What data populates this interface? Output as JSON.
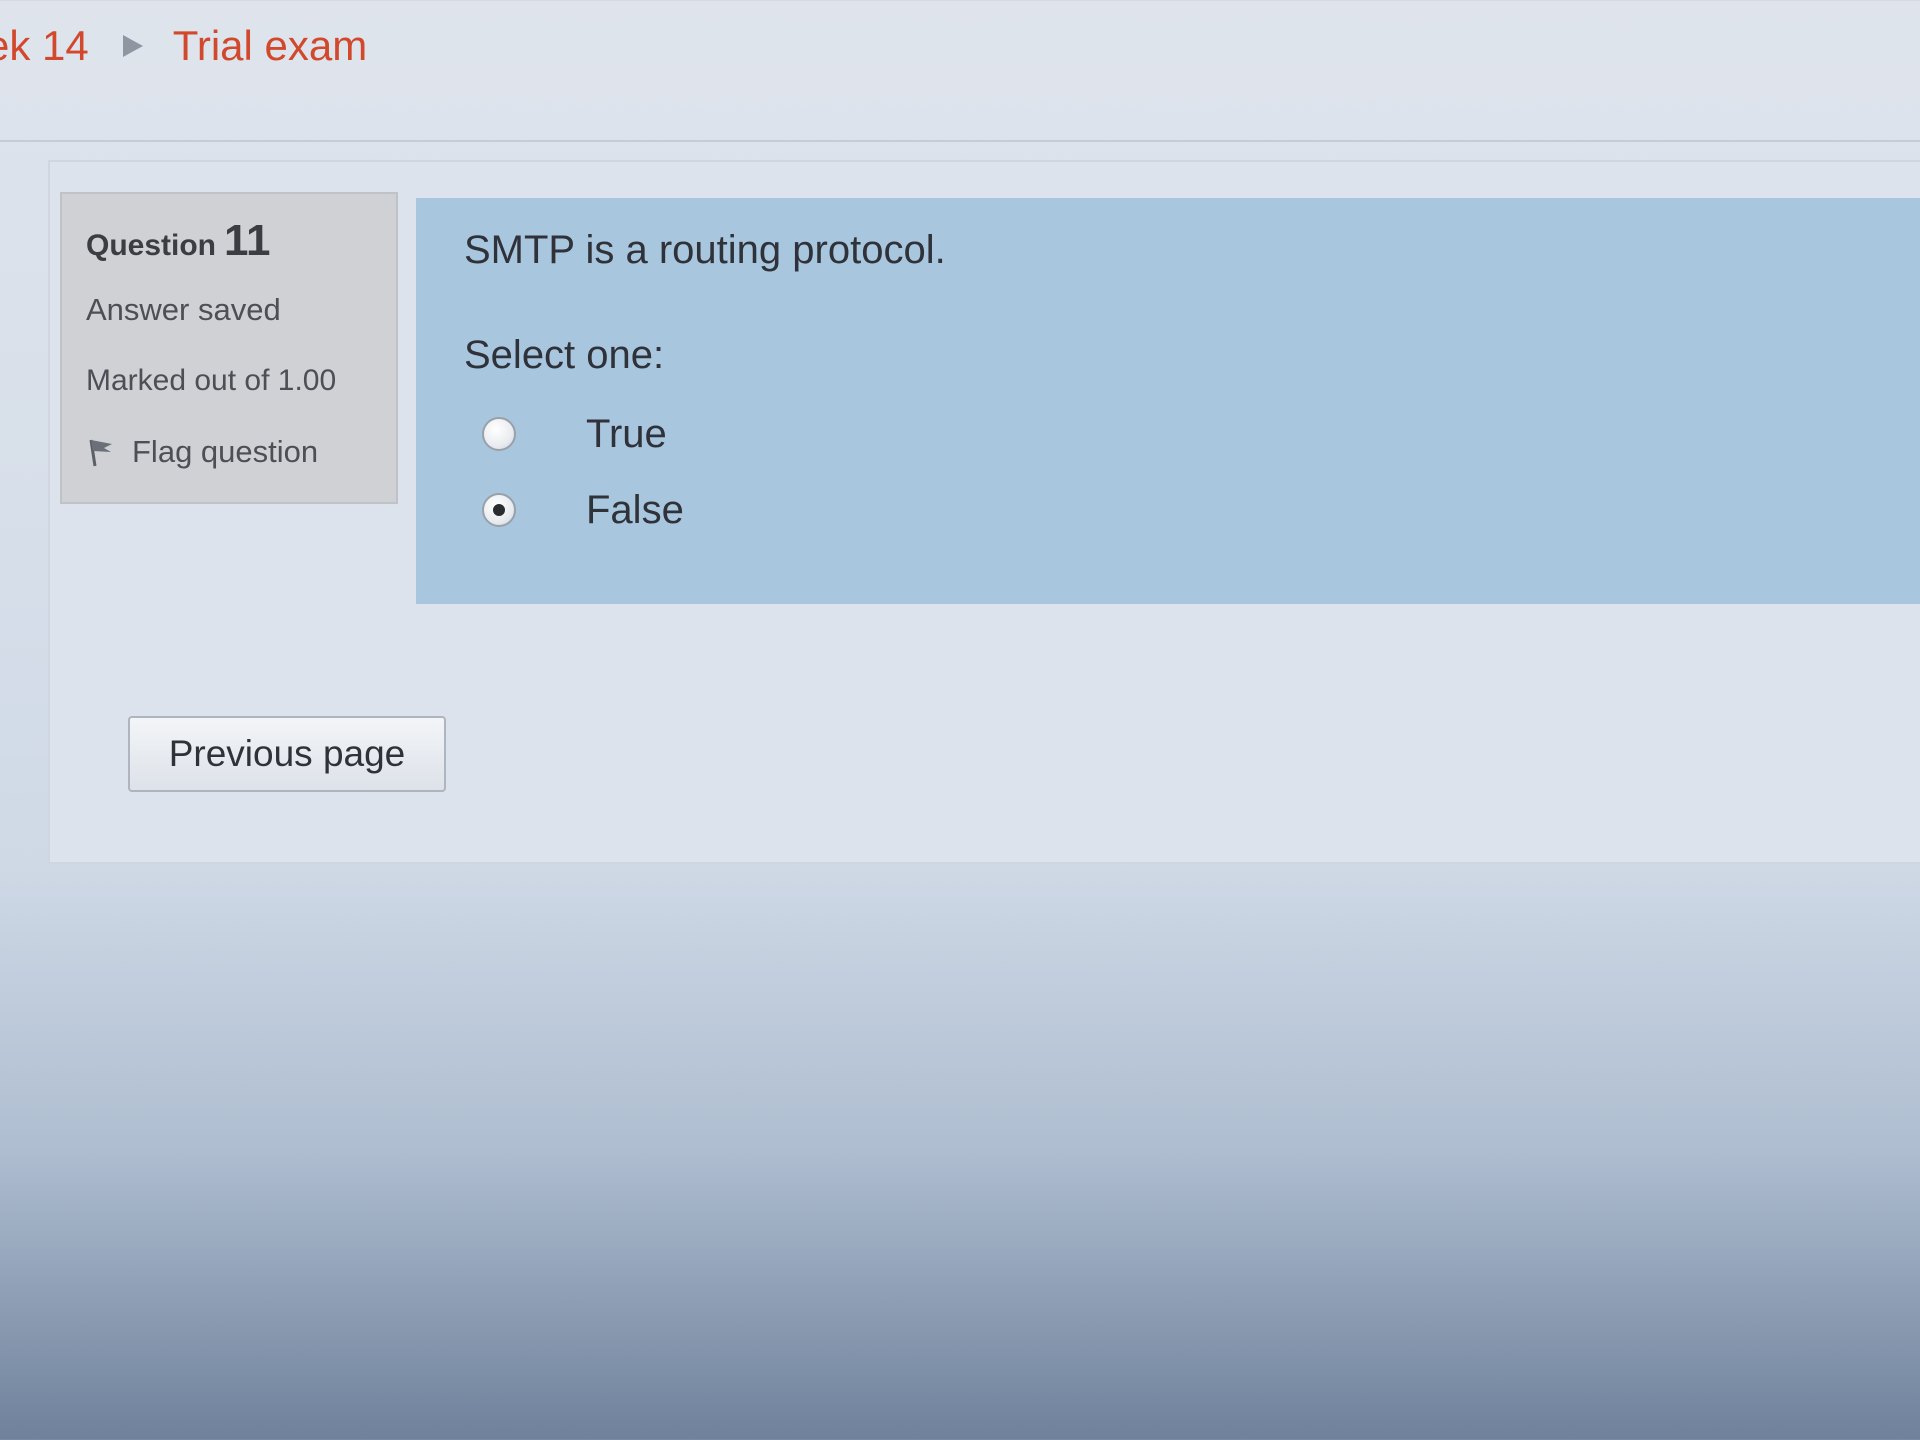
{
  "breadcrumb": {
    "items": [
      "ek 14",
      "Trial exam"
    ]
  },
  "question": {
    "heading_label": "Question",
    "number": "11",
    "state": "Answer saved",
    "grade": "Marked out of 1.00",
    "flag_label": "Flag question",
    "text": "SMTP is a routing protocol.",
    "prompt": "Select one:",
    "options": [
      {
        "label": "True",
        "selected": false
      },
      {
        "label": "False",
        "selected": true
      }
    ]
  },
  "navigation": {
    "previous_label": "Previous page"
  },
  "colors": {
    "breadcrumb_link": "#d2482c",
    "question_panel": "#a9c6df",
    "info_panel": "#cfd1d5"
  },
  "icons": {
    "breadcrumb_separator": "triangle-right-icon",
    "flag": "flag-icon",
    "radio_unchecked": "radio-unchecked-icon",
    "radio_checked": "radio-checked-icon"
  }
}
